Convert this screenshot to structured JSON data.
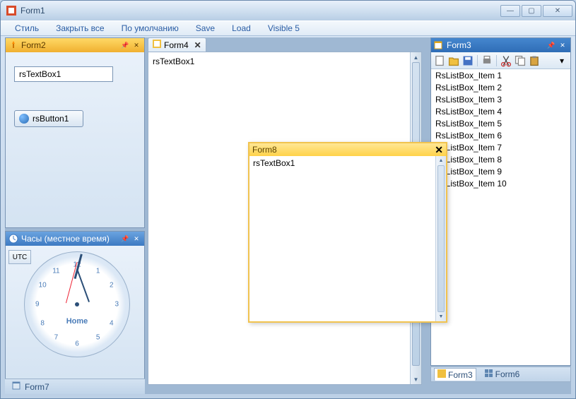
{
  "window": {
    "title": "Form1"
  },
  "caption": {
    "min": "—",
    "max": "▢",
    "close": "✕"
  },
  "menu": [
    "Стиль",
    "Закрыть все",
    "По умолчанию",
    "Save",
    "Load",
    "Visible 5"
  ],
  "form2": {
    "title": "Form2",
    "textbox": "rsTextBox1",
    "button": "rsButton1"
  },
  "clock": {
    "title": "Часы (местное время)",
    "utc": "UTC",
    "label": "Home",
    "numbers": [
      "12",
      "1",
      "2",
      "3",
      "4",
      "5",
      "6",
      "7",
      "8",
      "9",
      "10",
      "11"
    ]
  },
  "bottom_tab": "Form7",
  "form4": {
    "tab": "Form4",
    "text": "rsTextBox1"
  },
  "form3": {
    "title": "Form3",
    "items": [
      "RsListBox_Item 1",
      "RsListBox_Item 2",
      "RsListBox_Item 3",
      "RsListBox_Item 4",
      "RsListBox_Item 5",
      "RsListBox_Item 6",
      "RsListBox_Item 7",
      "RsListBox_Item 8",
      "RsListBox_Item 9",
      "RsListBox_Item 10"
    ]
  },
  "right_tabs": {
    "a": "Form3",
    "b": "Form6"
  },
  "form8": {
    "title": "Form8",
    "text": "rsTextBox1"
  }
}
